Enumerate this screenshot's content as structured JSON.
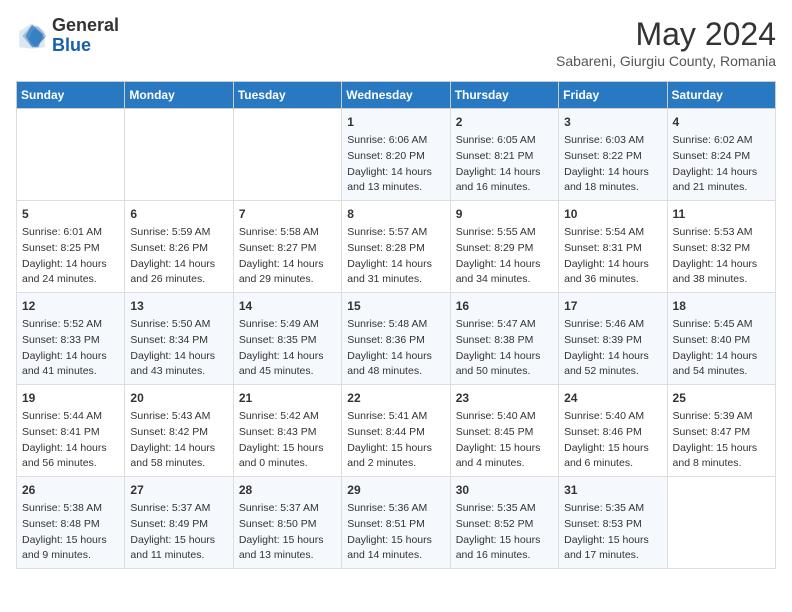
{
  "header": {
    "logo_general": "General",
    "logo_blue": "Blue",
    "month_year": "May 2024",
    "location": "Sabareni, Giurgiu County, Romania"
  },
  "weekdays": [
    "Sunday",
    "Monday",
    "Tuesday",
    "Wednesday",
    "Thursday",
    "Friday",
    "Saturday"
  ],
  "weeks": [
    [
      {
        "day": "",
        "info": ""
      },
      {
        "day": "",
        "info": ""
      },
      {
        "day": "",
        "info": ""
      },
      {
        "day": "1",
        "info": "Sunrise: 6:06 AM\nSunset: 8:20 PM\nDaylight: 14 hours\nand 13 minutes."
      },
      {
        "day": "2",
        "info": "Sunrise: 6:05 AM\nSunset: 8:21 PM\nDaylight: 14 hours\nand 16 minutes."
      },
      {
        "day": "3",
        "info": "Sunrise: 6:03 AM\nSunset: 8:22 PM\nDaylight: 14 hours\nand 18 minutes."
      },
      {
        "day": "4",
        "info": "Sunrise: 6:02 AM\nSunset: 8:24 PM\nDaylight: 14 hours\nand 21 minutes."
      }
    ],
    [
      {
        "day": "5",
        "info": "Sunrise: 6:01 AM\nSunset: 8:25 PM\nDaylight: 14 hours\nand 24 minutes."
      },
      {
        "day": "6",
        "info": "Sunrise: 5:59 AM\nSunset: 8:26 PM\nDaylight: 14 hours\nand 26 minutes."
      },
      {
        "day": "7",
        "info": "Sunrise: 5:58 AM\nSunset: 8:27 PM\nDaylight: 14 hours\nand 29 minutes."
      },
      {
        "day": "8",
        "info": "Sunrise: 5:57 AM\nSunset: 8:28 PM\nDaylight: 14 hours\nand 31 minutes."
      },
      {
        "day": "9",
        "info": "Sunrise: 5:55 AM\nSunset: 8:29 PM\nDaylight: 14 hours\nand 34 minutes."
      },
      {
        "day": "10",
        "info": "Sunrise: 5:54 AM\nSunset: 8:31 PM\nDaylight: 14 hours\nand 36 minutes."
      },
      {
        "day": "11",
        "info": "Sunrise: 5:53 AM\nSunset: 8:32 PM\nDaylight: 14 hours\nand 38 minutes."
      }
    ],
    [
      {
        "day": "12",
        "info": "Sunrise: 5:52 AM\nSunset: 8:33 PM\nDaylight: 14 hours\nand 41 minutes."
      },
      {
        "day": "13",
        "info": "Sunrise: 5:50 AM\nSunset: 8:34 PM\nDaylight: 14 hours\nand 43 minutes."
      },
      {
        "day": "14",
        "info": "Sunrise: 5:49 AM\nSunset: 8:35 PM\nDaylight: 14 hours\nand 45 minutes."
      },
      {
        "day": "15",
        "info": "Sunrise: 5:48 AM\nSunset: 8:36 PM\nDaylight: 14 hours\nand 48 minutes."
      },
      {
        "day": "16",
        "info": "Sunrise: 5:47 AM\nSunset: 8:38 PM\nDaylight: 14 hours\nand 50 minutes."
      },
      {
        "day": "17",
        "info": "Sunrise: 5:46 AM\nSunset: 8:39 PM\nDaylight: 14 hours\nand 52 minutes."
      },
      {
        "day": "18",
        "info": "Sunrise: 5:45 AM\nSunset: 8:40 PM\nDaylight: 14 hours\nand 54 minutes."
      }
    ],
    [
      {
        "day": "19",
        "info": "Sunrise: 5:44 AM\nSunset: 8:41 PM\nDaylight: 14 hours\nand 56 minutes."
      },
      {
        "day": "20",
        "info": "Sunrise: 5:43 AM\nSunset: 8:42 PM\nDaylight: 14 hours\nand 58 minutes."
      },
      {
        "day": "21",
        "info": "Sunrise: 5:42 AM\nSunset: 8:43 PM\nDaylight: 15 hours\nand 0 minutes."
      },
      {
        "day": "22",
        "info": "Sunrise: 5:41 AM\nSunset: 8:44 PM\nDaylight: 15 hours\nand 2 minutes."
      },
      {
        "day": "23",
        "info": "Sunrise: 5:40 AM\nSunset: 8:45 PM\nDaylight: 15 hours\nand 4 minutes."
      },
      {
        "day": "24",
        "info": "Sunrise: 5:40 AM\nSunset: 8:46 PM\nDaylight: 15 hours\nand 6 minutes."
      },
      {
        "day": "25",
        "info": "Sunrise: 5:39 AM\nSunset: 8:47 PM\nDaylight: 15 hours\nand 8 minutes."
      }
    ],
    [
      {
        "day": "26",
        "info": "Sunrise: 5:38 AM\nSunset: 8:48 PM\nDaylight: 15 hours\nand 9 minutes."
      },
      {
        "day": "27",
        "info": "Sunrise: 5:37 AM\nSunset: 8:49 PM\nDaylight: 15 hours\nand 11 minutes."
      },
      {
        "day": "28",
        "info": "Sunrise: 5:37 AM\nSunset: 8:50 PM\nDaylight: 15 hours\nand 13 minutes."
      },
      {
        "day": "29",
        "info": "Sunrise: 5:36 AM\nSunset: 8:51 PM\nDaylight: 15 hours\nand 14 minutes."
      },
      {
        "day": "30",
        "info": "Sunrise: 5:35 AM\nSunset: 8:52 PM\nDaylight: 15 hours\nand 16 minutes."
      },
      {
        "day": "31",
        "info": "Sunrise: 5:35 AM\nSunset: 8:53 PM\nDaylight: 15 hours\nand 17 minutes."
      },
      {
        "day": "",
        "info": ""
      }
    ]
  ]
}
